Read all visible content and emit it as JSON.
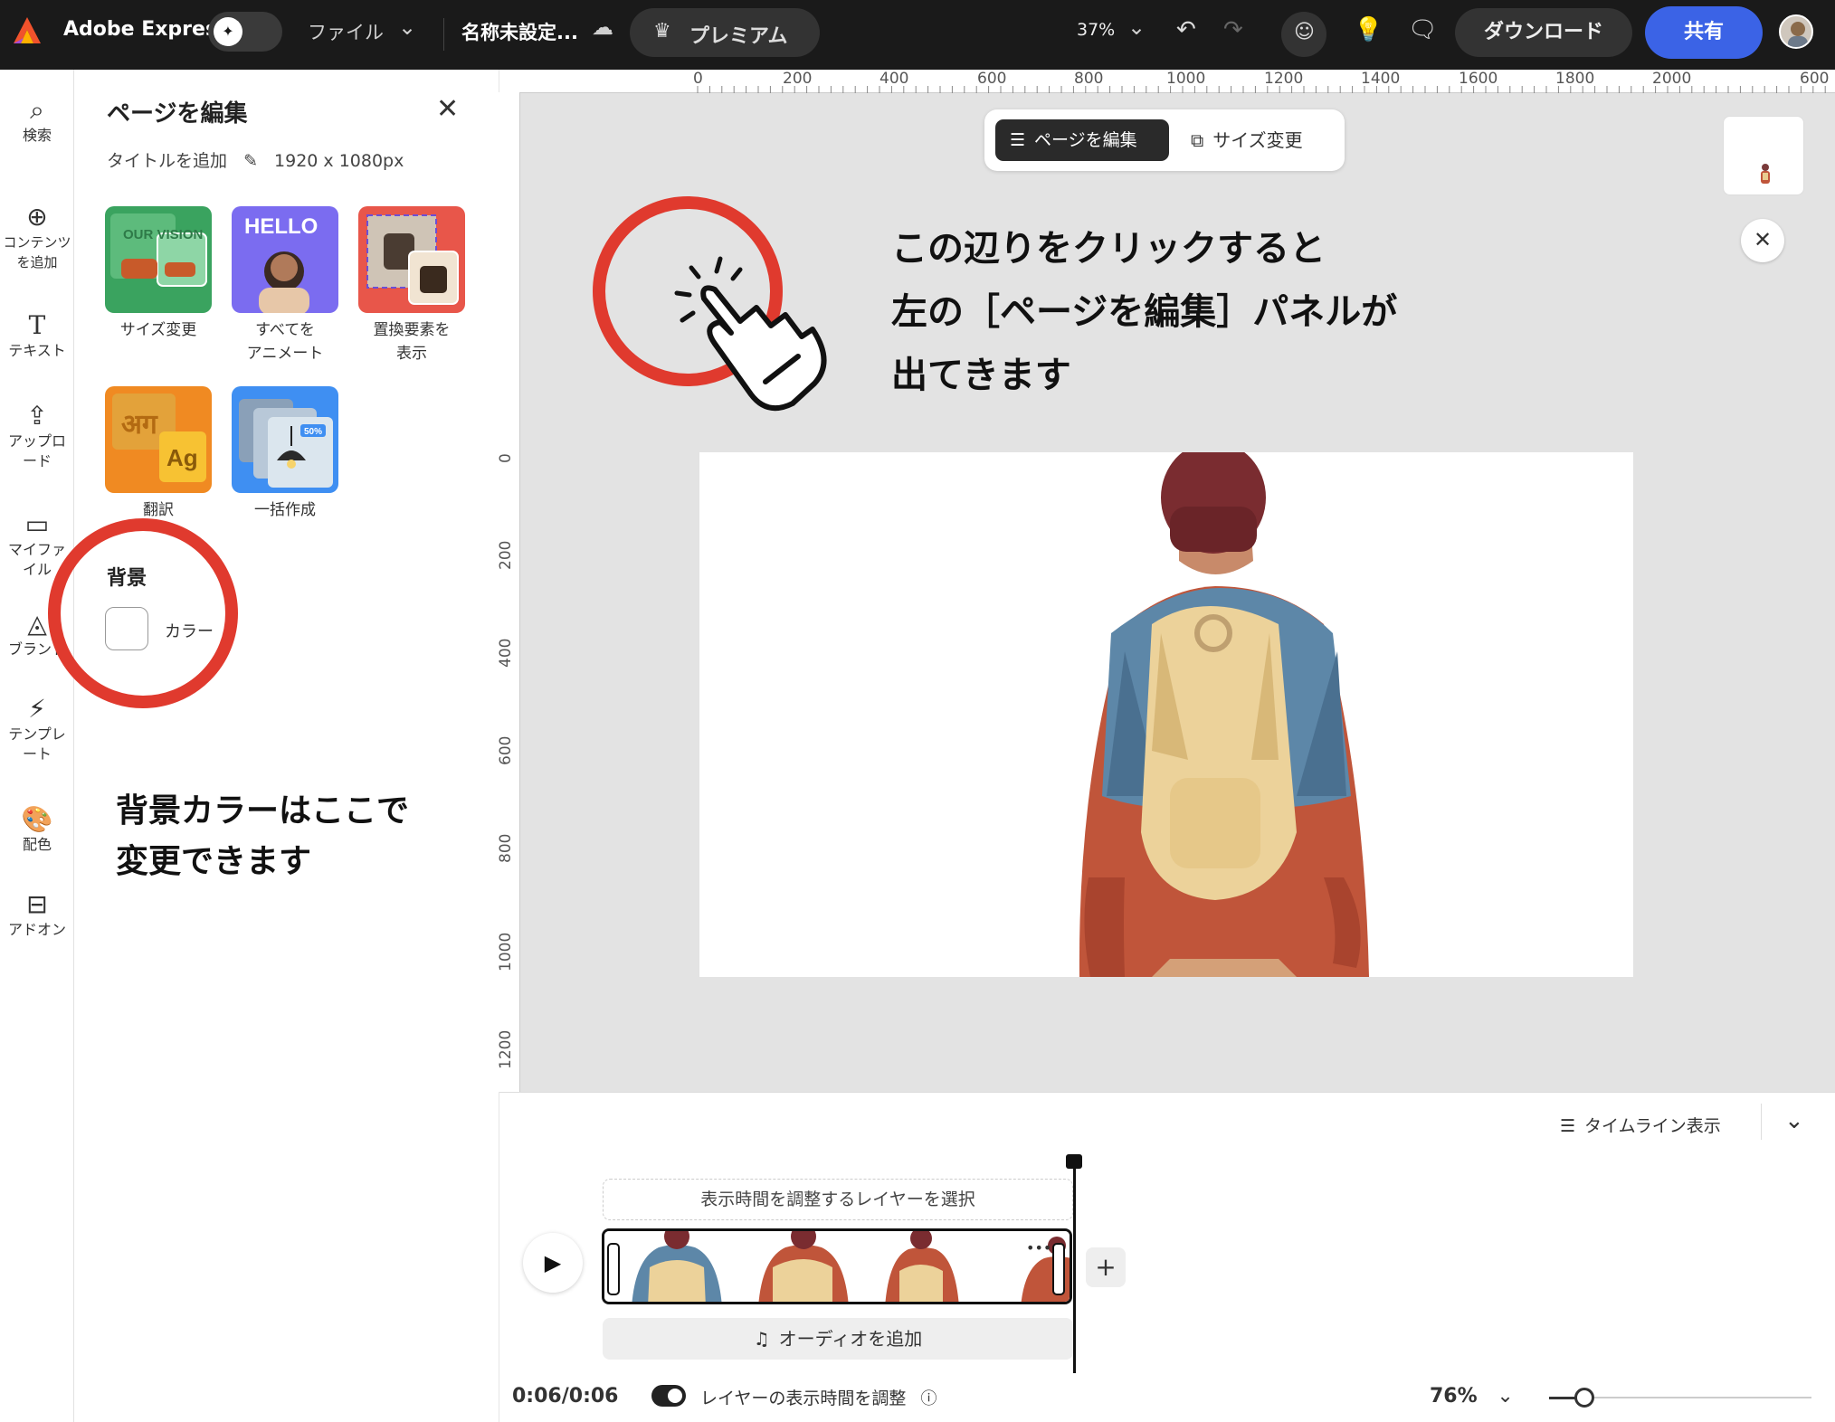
{
  "topbar": {
    "app_name": "Adobe Express",
    "file_menu": "ファイル",
    "doc_title": "名称未設定...",
    "premium": "プレミアム",
    "zoom": "37%",
    "download": "ダウンロード",
    "share": "共有"
  },
  "leftnav": {
    "items": [
      {
        "label": "検索",
        "icon": "search-icon"
      },
      {
        "label": "コンテンツを追加",
        "icon": "plus-circle-icon"
      },
      {
        "label": "テキスト",
        "icon": "text-icon"
      },
      {
        "label": "アップロード",
        "icon": "upload-icon"
      },
      {
        "label": "マイファイル",
        "icon": "folder-icon"
      },
      {
        "label": "ブランド",
        "icon": "brand-icon"
      },
      {
        "label": "テンプレート",
        "icon": "template-icon"
      },
      {
        "label": "配色",
        "icon": "palette-icon"
      },
      {
        "label": "アドオン",
        "icon": "addon-icon"
      }
    ]
  },
  "panel": {
    "title": "ページを編集",
    "add_title": "タイトルを追加",
    "dimensions": "1920 x 1080px",
    "tools": [
      {
        "label": "サイズ変更",
        "label2": ""
      },
      {
        "label": "すべてを",
        "label2": "アニメート"
      },
      {
        "label": "置換要素を",
        "label2": "表示"
      },
      {
        "label": "翻訳",
        "label2": ""
      },
      {
        "label": "一括作成",
        "label2": ""
      }
    ],
    "tile_text": {
      "resize": "OUR VISION",
      "animate": "HELLO",
      "translate_a": "अग",
      "translate_b": "Ag",
      "bulk_badge": "50%"
    },
    "background_title": "背景",
    "color_label": "カラー"
  },
  "annotations": {
    "panel_note_1": "背景カラーはここで",
    "panel_note_2": "変更できます",
    "canvas_note_1": "この辺りをクリックすると",
    "canvas_note_2": "左の［ページを編集］パネルが",
    "canvas_note_3": "出てきます",
    "highlight_color": "#e03a2e"
  },
  "canvas": {
    "edit_page_button": "ページを編集",
    "resize_button": "サイズ変更",
    "ruler_h": [
      "0",
      "200",
      "400",
      "600",
      "800",
      "1000",
      "1200",
      "1400",
      "1600",
      "1800",
      "2000",
      "600"
    ],
    "ruler_v": [
      "0",
      "200",
      "400",
      "600",
      "800",
      "1000",
      "1200"
    ]
  },
  "timeline": {
    "view_label": "タイムライン表示",
    "hint": "表示時間を調整するレイヤーを選択",
    "add_audio": "オーディオを追加",
    "time": "0:06/0:06",
    "adjust_label": "レイヤーの表示時間を調整",
    "zoom": "76%"
  },
  "colors": {
    "accent_blue": "#3b63e6",
    "topbar_bg": "#1a1a1a"
  }
}
